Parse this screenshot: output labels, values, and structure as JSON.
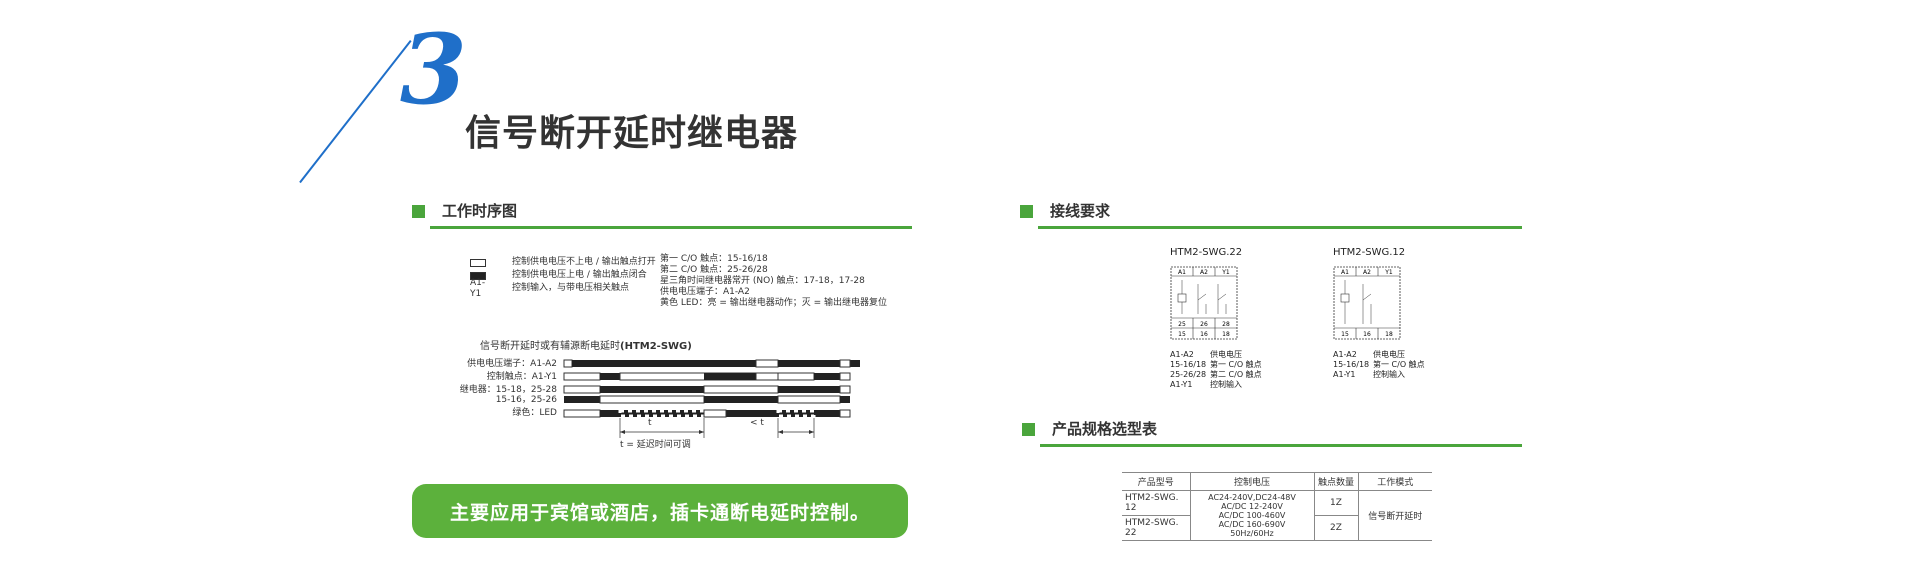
{
  "header": {
    "number": "3",
    "title": "信号断开延时继电器"
  },
  "timing": {
    "heading": "工作时序图",
    "legend": [
      {
        "symbol": "",
        "text": "控制供电电压不上电 / 输出触点打开"
      },
      {
        "symbol": "",
        "text": "控制供电电压上电 / 输出触点闭合"
      },
      {
        "symbol": "A1-Y1",
        "text": "控制输入，与带电压相关触点"
      }
    ],
    "notes": [
      "第一 C/O 触点：15-16/18",
      "第二 C/O 触点：25-26/28",
      "星三角时间继电器常开 (NO) 触点：17-18，17-28",
      "供电电压端子：A1-A2",
      "黄色 LED：亮 = 输出继电器动作；灭 = 输出继电器复位"
    ],
    "diagram_title": "信号断开延时或有辅源断电延时",
    "diagram_model": "(HTM2-SWG)",
    "rows": [
      "供电电压端子：A1-A2",
      "控制触点：A1-Y1",
      "继电器：15-18，25-28",
      "15-16，25-26",
      "绿色：LED"
    ],
    "t_label": "t",
    "t_lt_label": "< t",
    "t_caption": "t = 延迟时间可调"
  },
  "cta": {
    "text": "主要应用于宾馆或酒店，插卡通断电延时控制。"
  },
  "wiring": {
    "heading": "接线要求",
    "models": [
      {
        "name": "HTM2-SWG.22",
        "top_terms": [
          "A1",
          "A2",
          "Y1"
        ],
        "bottom_terms_1": [
          "25",
          "26",
          "28"
        ],
        "bottom_terms_2": [
          "15",
          "16",
          "18"
        ],
        "legend": [
          {
            "code": "A1-A2",
            "desc": "供电电压"
          },
          {
            "code": "15-16/18",
            "desc": "第一 C/O 触点"
          },
          {
            "code": "25-26/28",
            "desc": "第二 C/O 触点"
          },
          {
            "code": "A1-Y1",
            "desc": "控制输入"
          }
        ]
      },
      {
        "name": "HTM2-SWG.12",
        "top_terms": [
          "A1",
          "A2",
          "Y1"
        ],
        "bottom_terms_2": [
          "15",
          "16",
          "18"
        ],
        "legend": [
          {
            "code": "A1-A2",
            "desc": "供电电压"
          },
          {
            "code": "15-16/18",
            "desc": "第一 C/O 触点"
          },
          {
            "code": "A1-Y1",
            "desc": "控制输入"
          }
        ]
      }
    ]
  },
  "spec": {
    "heading": "产品规格选型表",
    "columns": [
      "产品型号",
      "控制电压",
      "触点数量",
      "工作模式"
    ],
    "rows": [
      {
        "model": "HTM2-SWG. 12",
        "contacts": "1Z"
      },
      {
        "model": "HTM2-SWG. 22",
        "contacts": "2Z"
      }
    ],
    "voltage_lines": [
      "AC24-240V,DC24-48V",
      "AC/DC 12-240V",
      "AC/DC 100-460V",
      "AC/DC 160-690V",
      "50Hz/60Hz"
    ],
    "mode": "信号断开延时"
  },
  "colors": {
    "accent_green": "#4aa53c",
    "cta_green": "#5cb13c",
    "number_blue": "#1f6fc9"
  }
}
